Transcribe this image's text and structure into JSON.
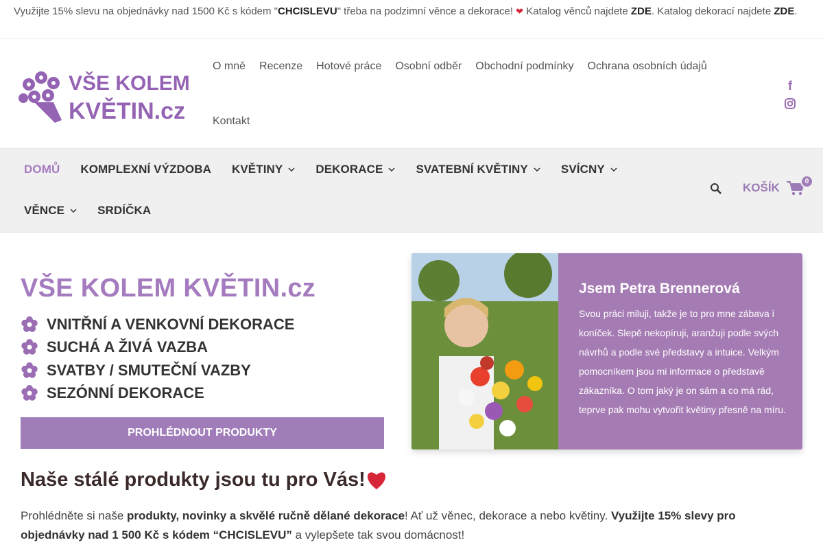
{
  "promo": {
    "part1": "Využijte 15% slevu na objednávky nad 1500 Kč s kódem \"",
    "code": "CHCISLEVU",
    "part2": "\" třeba na podzimní věnce a dekorace! ",
    "part3": " Katalog věnců najdete ",
    "link1": "ZDE",
    "part4": ". Katalog dekorací najdete ",
    "link2": "ZDE",
    "part5": "."
  },
  "logo": {
    "line1": "VŠE KOLEM",
    "line2": "KVĚTIN.cz"
  },
  "topnav": {
    "items": [
      "O mně",
      "Recenze",
      "Hotové práce",
      "Osobní odběr",
      "Obchodní podmínky",
      "Ochrana osobních údajů",
      "Kontakt"
    ]
  },
  "social": {
    "facebook": "f",
    "instagram": "instagram-icon"
  },
  "mainnav": {
    "items": [
      "DOMŮ",
      "KOMPLEXNÍ VÝZDOBA",
      "KVĚTINY",
      "DEKORACE",
      "SVATEBNÍ KVĚTINY",
      "SVÍCNY",
      "VĚNCE",
      "SRDÍČKA"
    ],
    "cart_label": "KOŠÍK",
    "cart_count": "0"
  },
  "hero": {
    "title": "VŠE KOLEM KVĚTIN.cz",
    "bullets": [
      "VNITŘNÍ A VENKOVNÍ DEKORACE",
      "SUCHÁ A ŽIVÁ VAZBA",
      "SVATBY / SMUTEČNÍ VAZBY",
      "SEZÓNNÍ DEKORACE"
    ],
    "cta": "PROHLÉDNOUT PRODUKTY"
  },
  "card": {
    "name": "Jsem Petra Brennerová",
    "bio": "Svou práci miluji, takže je to pro mne zábava i koníček. Slepě nekopíruji, aranžuji podle svých návrhů a podle své představy a intuice. Velkým pomocníkem jsou mi informace o představě zákazníka. O tom jaký je on sám a co má rád, teprve pak mohu vytvořit květiny přesně na míru."
  },
  "products": {
    "heading": "Naše stálé produkty jsou tu pro Vás!",
    "p1": "Prohlédněte si naše ",
    "p2": "produkty, novinky a skvělé ručně dělané dekorace",
    "p3": "! Ať už věnec, dekorace a nebo květiny. ",
    "p4": "Využijte 15% slevy pro objednávky nad 1 500 Kč s kódem “CHCISLEVU”",
    "p5": " a vylepšete tak svou domácnost!"
  },
  "colors": {
    "accent": "#a57bbf",
    "button": "#a07cb8",
    "card": "#a57bb3"
  }
}
